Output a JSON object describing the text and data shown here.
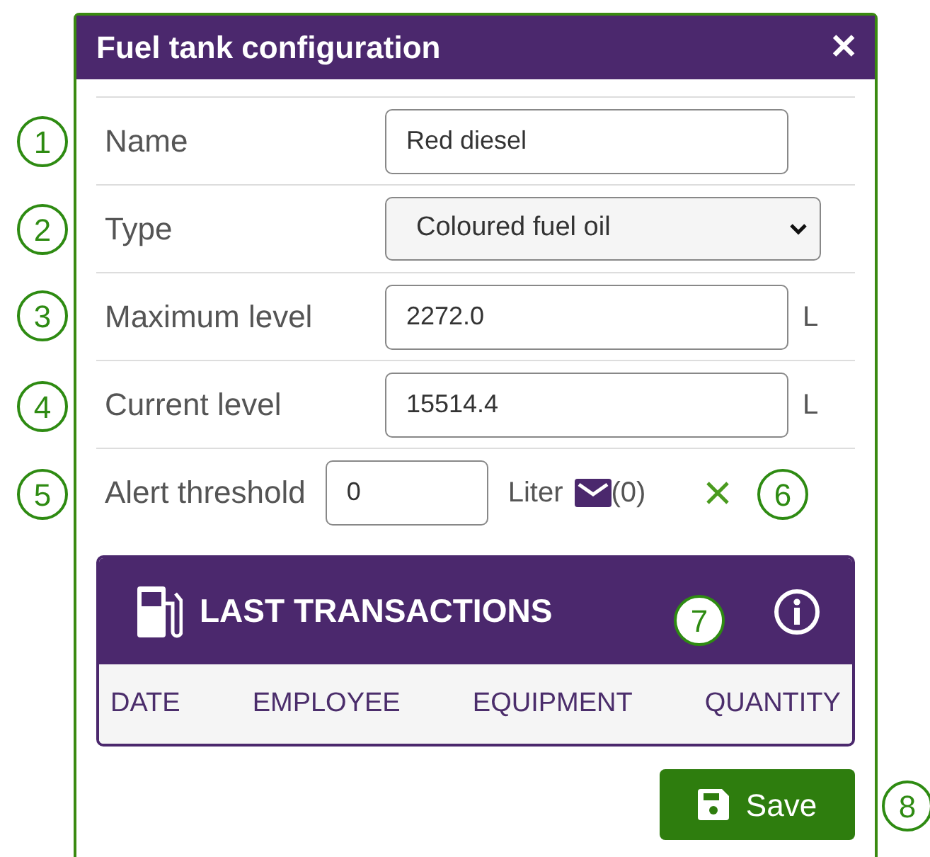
{
  "dialog": {
    "title": "Fuel tank configuration",
    "close": "✕"
  },
  "fields": [
    {
      "kind": "text",
      "label": "Name",
      "value": "Red diesel"
    },
    {
      "kind": "select",
      "label": "Type",
      "value": "Coloured fuel oil"
    },
    {
      "kind": "text",
      "label": "Maximum level",
      "value": "2272.0",
      "unit": "L"
    },
    {
      "kind": "text",
      "label": "Current level",
      "value": "15514.4",
      "unit": "L"
    },
    {
      "kind": "threshold",
      "label": "Alert threshold",
      "value": "0",
      "unit": "Liter",
      "count": "(0)"
    }
  ],
  "transactions": {
    "title": "LAST TRANSACTIONS",
    "columns": [
      "DATE",
      "EMPLOYEE",
      "EQUIPMENT",
      "QUANTITY"
    ]
  },
  "save_button": "Save",
  "callouts": [
    "1",
    "2",
    "3",
    "4",
    "5",
    "6",
    "7",
    "8"
  ]
}
